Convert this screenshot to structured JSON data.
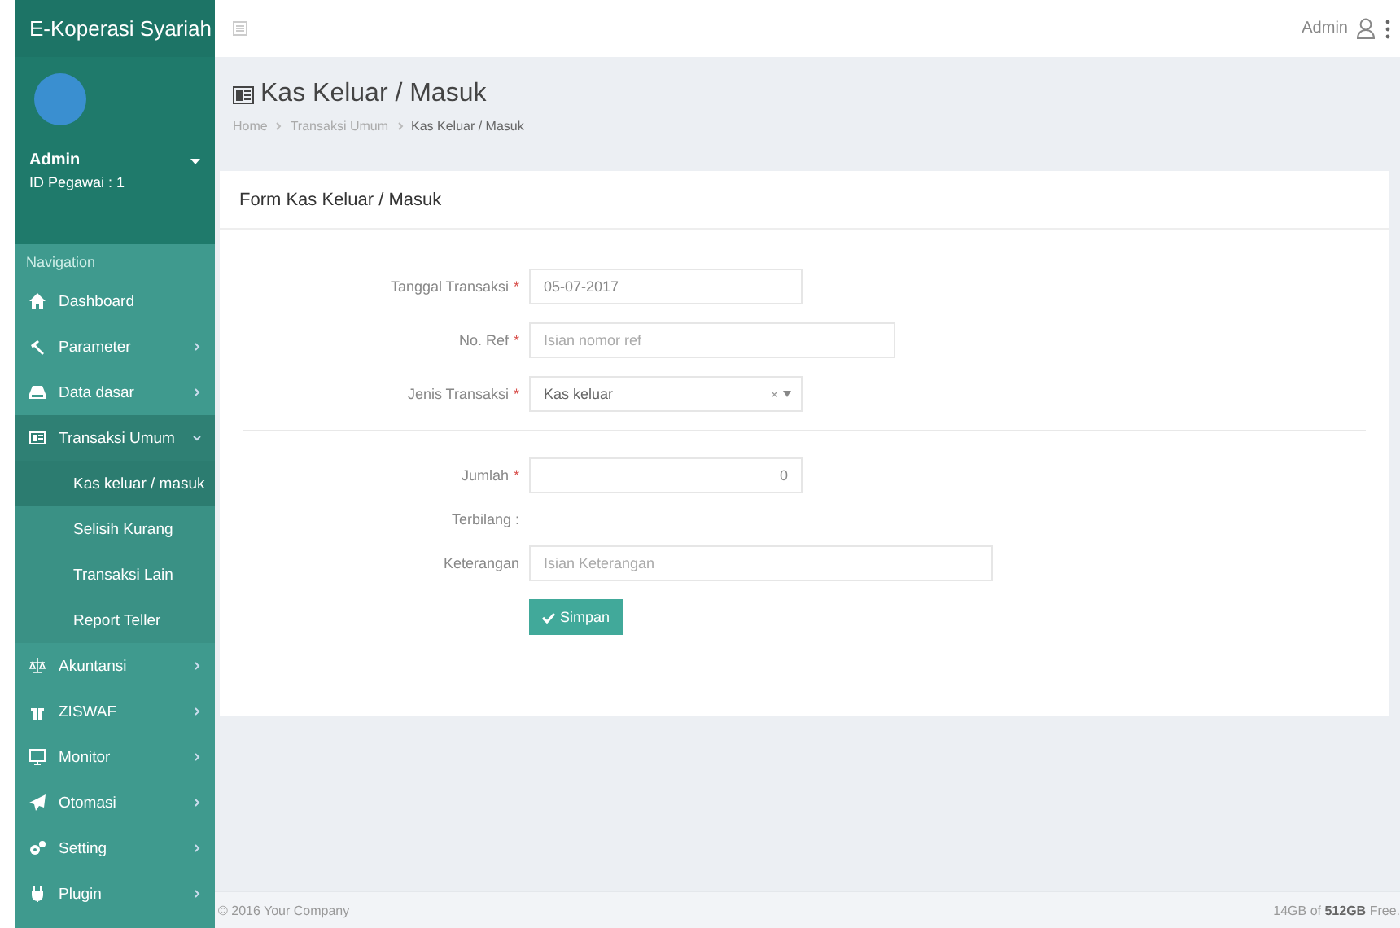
{
  "sidebar": {
    "brand": "E-Koperasi Syariah",
    "user": {
      "name": "Admin",
      "id_label": "ID Pegawai : 1"
    },
    "nav_heading": "Navigation",
    "items": [
      {
        "label": "Dashboard",
        "selected": false
      },
      {
        "label": "Parameter",
        "selected": false,
        "expanded": false
      },
      {
        "label": "Data dasar",
        "selected": false,
        "expanded": false
      },
      {
        "label": "Transaksi Umum",
        "selected": true,
        "expanded": true,
        "children": [
          {
            "label": "Kas keluar / masuk",
            "selected": true
          },
          {
            "label": "Selisih Kurang",
            "selected": false
          },
          {
            "label": "Transaksi Lain",
            "selected": false
          },
          {
            "label": "Report Teller",
            "selected": false
          }
        ]
      },
      {
        "label": "Akuntansi",
        "selected": false,
        "expanded": false
      },
      {
        "label": "ZISWAF",
        "selected": false,
        "expanded": false
      },
      {
        "label": "Monitor",
        "selected": false,
        "expanded": false
      },
      {
        "label": "Otomasi",
        "selected": false,
        "expanded": false
      },
      {
        "label": "Setting",
        "selected": false,
        "expanded": false
      },
      {
        "label": "Plugin",
        "selected": false,
        "expanded": false
      }
    ]
  },
  "topbar": {
    "user": "Admin"
  },
  "page": {
    "title": "Kas Keluar / Masuk",
    "breadcrumb": [
      "Home",
      "Transaksi Umum",
      "Kas Keluar / Masuk"
    ]
  },
  "form": {
    "title": "Form Kas Keluar / Masuk",
    "fields": [
      {
        "kind": "text",
        "label": "Tanggal Transaksi",
        "required_mark": "*",
        "value": "05-07-2017"
      },
      {
        "kind": "text",
        "label": "No. Ref",
        "required_mark": "*",
        "placeholder": "Isian nomor ref"
      },
      {
        "kind": "select",
        "label": "Jenis Transaksi",
        "required_mark": "*",
        "value": "Kas keluar",
        "clear": "×"
      },
      {
        "kind": "divider"
      },
      {
        "kind": "number",
        "label": "Jumlah",
        "required_mark": "*",
        "value": "0"
      },
      {
        "kind": "static",
        "label": "Terbilang :"
      },
      {
        "kind": "text",
        "label": "Keterangan",
        "placeholder": "Isian Keterangan"
      }
    ],
    "submit": "Simpan"
  },
  "footer": {
    "left": "© 2016 Your Company",
    "right": "14GB of **512GB** Free."
  }
}
